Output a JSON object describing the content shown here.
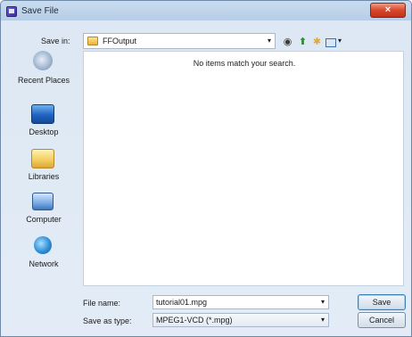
{
  "window": {
    "title": "Save File",
    "close_label": "×"
  },
  "toolbar": {
    "save_in_label": "Save in:",
    "location": "FFOutput",
    "combo_arrow": "▾",
    "back_glyph": "◉",
    "up_glyph": "⬆",
    "newfolder_glyph": "✱",
    "views_arrow": "▾"
  },
  "places": [
    {
      "label": "Recent Places",
      "icon": "recent-places-icon"
    },
    {
      "label": "Desktop",
      "icon": "desktop-icon"
    },
    {
      "label": "Libraries",
      "icon": "libraries-icon"
    },
    {
      "label": "Computer",
      "icon": "computer-icon"
    },
    {
      "label": "Network",
      "icon": "network-icon"
    }
  ],
  "file_list": {
    "empty_message": "No items match your search."
  },
  "form": {
    "file_name_label": "File name:",
    "file_name_value": "tutorial01.mpg",
    "save_as_type_label": "Save as type:",
    "save_as_type_value": "MPEG1-VCD (*.mpg)",
    "dropdown_arrow": "▾"
  },
  "buttons": {
    "save": "Save",
    "cancel": "Cancel"
  }
}
